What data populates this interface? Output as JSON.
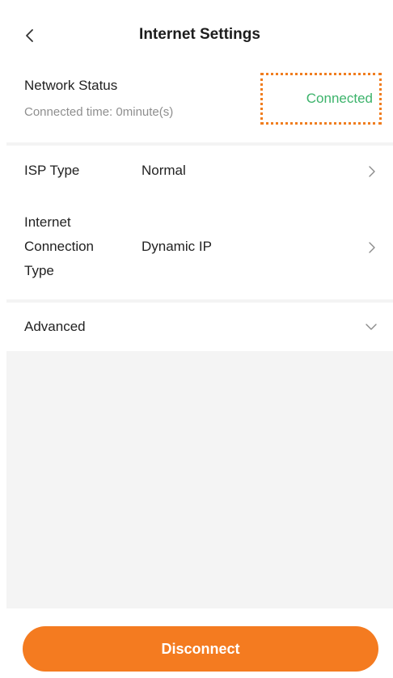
{
  "header": {
    "title": "Internet Settings",
    "back_icon": "chevron-left-icon"
  },
  "network_status": {
    "label": "Network Status",
    "connected_time": "Connected time: 0minute(s)",
    "status": "Connected",
    "status_color": "#3cb36b",
    "highlight_color": "#f07d1f"
  },
  "settings": {
    "isp_type": {
      "label": "ISP Type",
      "value": "Normal"
    },
    "connection_type": {
      "label_line1": "Internet",
      "label_line2": "Connection",
      "label_line3": "Type",
      "value": "Dynamic IP"
    }
  },
  "advanced": {
    "label": "Advanced",
    "icon": "chevron-down-icon"
  },
  "footer": {
    "disconnect_label": "Disconnect",
    "button_color": "#f47b20"
  }
}
